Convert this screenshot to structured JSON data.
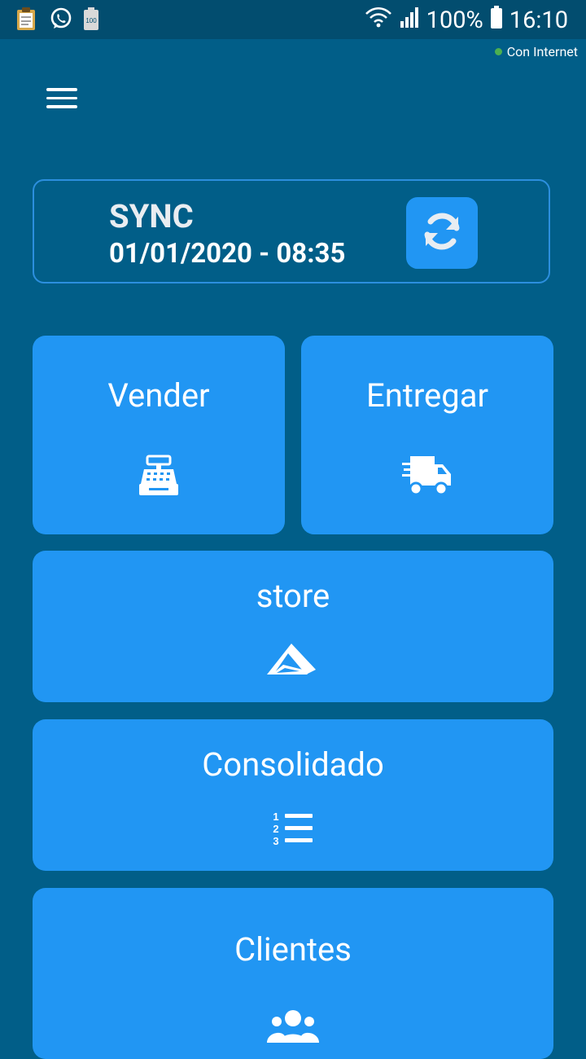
{
  "status_bar": {
    "battery_percent": "100%",
    "time": "16:10",
    "left_icons": [
      "clipboard-icon",
      "whatsapp-icon",
      "battery-100-icon"
    ],
    "right_icons": [
      "wifi-icon",
      "signal-icon",
      "battery-icon"
    ]
  },
  "header": {
    "connection_status": "Con Internet",
    "connection_color": "#4caf50",
    "menu_icon": "hamburger-icon"
  },
  "sync": {
    "title": "SYNC",
    "datetime": "01/01/2020 - 08:35",
    "button_icon": "sync-icon"
  },
  "tiles": {
    "vender": {
      "label": "Vender",
      "icon": "cash-register-icon"
    },
    "entregar": {
      "label": "Entregar",
      "icon": "delivery-truck-icon"
    },
    "store": {
      "label": "store",
      "icon": "store-logo-icon"
    },
    "consolidado": {
      "label": "Consolidado",
      "icon": "numbered-list-icon"
    },
    "clientes": {
      "label": "Clientes",
      "icon": "users-icon"
    }
  },
  "colors": {
    "background": "#015e88",
    "status_bar": "#024d6f",
    "tile": "#2196f3",
    "sync_border": "#2c8fde"
  }
}
